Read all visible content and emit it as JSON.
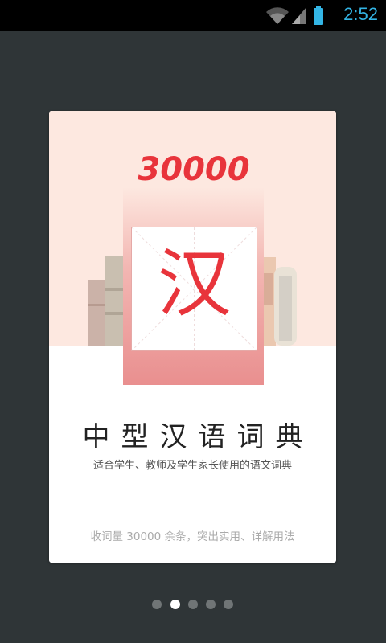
{
  "status_bar": {
    "time": "2:52",
    "icons": [
      "wifi-icon",
      "signal-icon",
      "battery-icon"
    ],
    "accent_color": "#33b5e5"
  },
  "splash": {
    "logo_number": "30000",
    "character": "汉",
    "title": "中型汉语词典",
    "subtitle": "适合学生、教师及学生家长使用的语文词典",
    "note": "收词量 30000 余条，突出实用、详解用法",
    "brand_color": "#e8343b"
  },
  "pager": {
    "page_count": 5,
    "active_index": 1
  }
}
